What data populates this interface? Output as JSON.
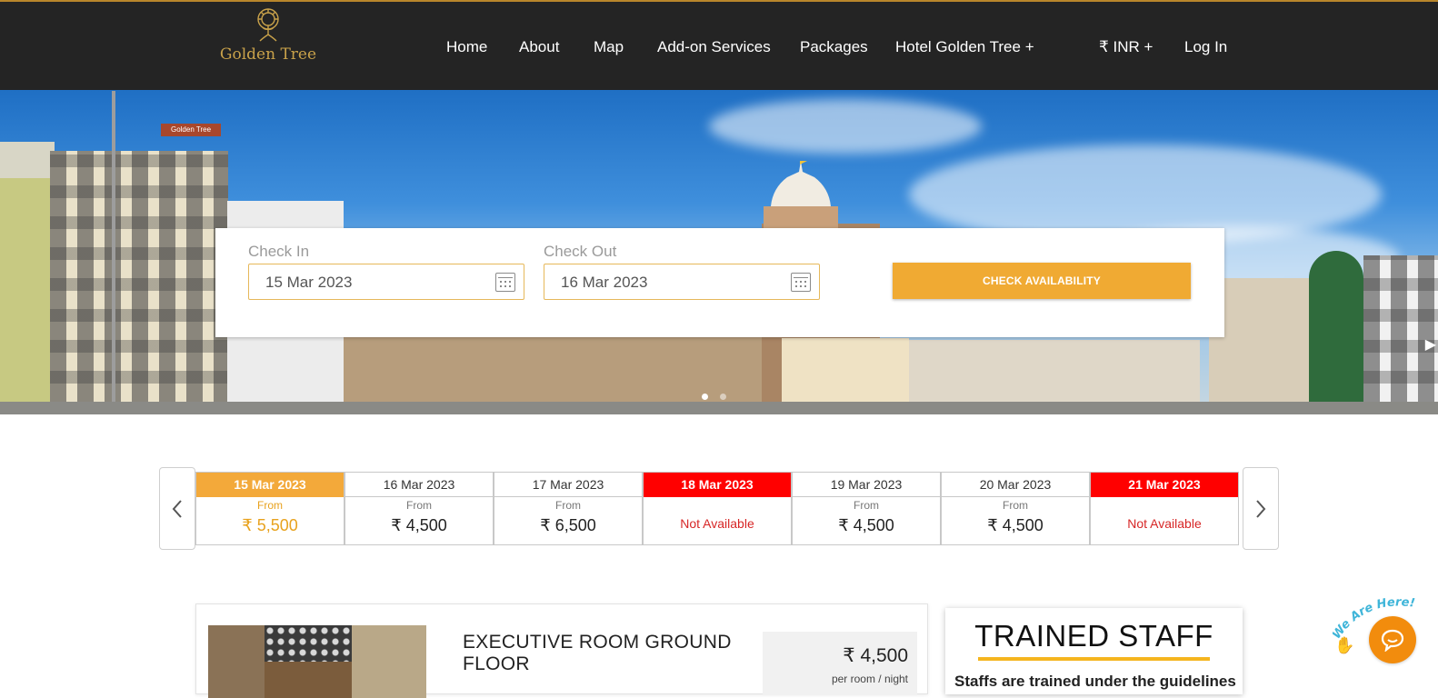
{
  "brand": {
    "name": "Golden Tree"
  },
  "nav": {
    "items": [
      "Home",
      "About",
      "Map",
      "Add-on Services",
      "Packages",
      "Hotel Golden Tree +"
    ],
    "currency": "₹ INR +",
    "login": "Log In"
  },
  "hero": {
    "hotel_sign": "Golden Tree",
    "slide_count": 2,
    "active_slide": 1
  },
  "booking": {
    "checkin_label": "Check In",
    "checkin_value": "15 Mar 2023",
    "checkout_label": "Check Out",
    "checkout_value": "16 Mar 2023",
    "button_label": "CHECK AVAILABILITY"
  },
  "rates": {
    "from_label": "From",
    "na_label": "Not Available",
    "days": [
      {
        "date": "15 Mar 2023",
        "price": "₹ 5,500",
        "status": "selected"
      },
      {
        "date": "16 Mar 2023",
        "price": "₹ 4,500",
        "status": "available"
      },
      {
        "date": "17 Mar 2023",
        "price": "₹ 6,500",
        "status": "available"
      },
      {
        "date": "18 Mar 2023",
        "price": "",
        "status": "not-available"
      },
      {
        "date": "19 Mar 2023",
        "price": "₹ 4,500",
        "status": "available"
      },
      {
        "date": "20 Mar 2023",
        "price": "₹ 4,500",
        "status": "available"
      },
      {
        "date": "21 Mar 2023",
        "price": "",
        "status": "not-available"
      }
    ]
  },
  "room": {
    "title": "EXECUTIVE ROOM GROUND FLOOR",
    "price": "₹ 4,500",
    "unit": "per room / night"
  },
  "feature": {
    "title": "TRAINED STAFF",
    "text": "Staffs are trained under the guidelines"
  },
  "chat": {
    "badge": "We Are Here!"
  },
  "colors": {
    "accent": "#f0aa33",
    "header": "#242424",
    "unavailable": "#ff0000",
    "gold": "#c9a24a",
    "chat": "#f28c0d"
  }
}
